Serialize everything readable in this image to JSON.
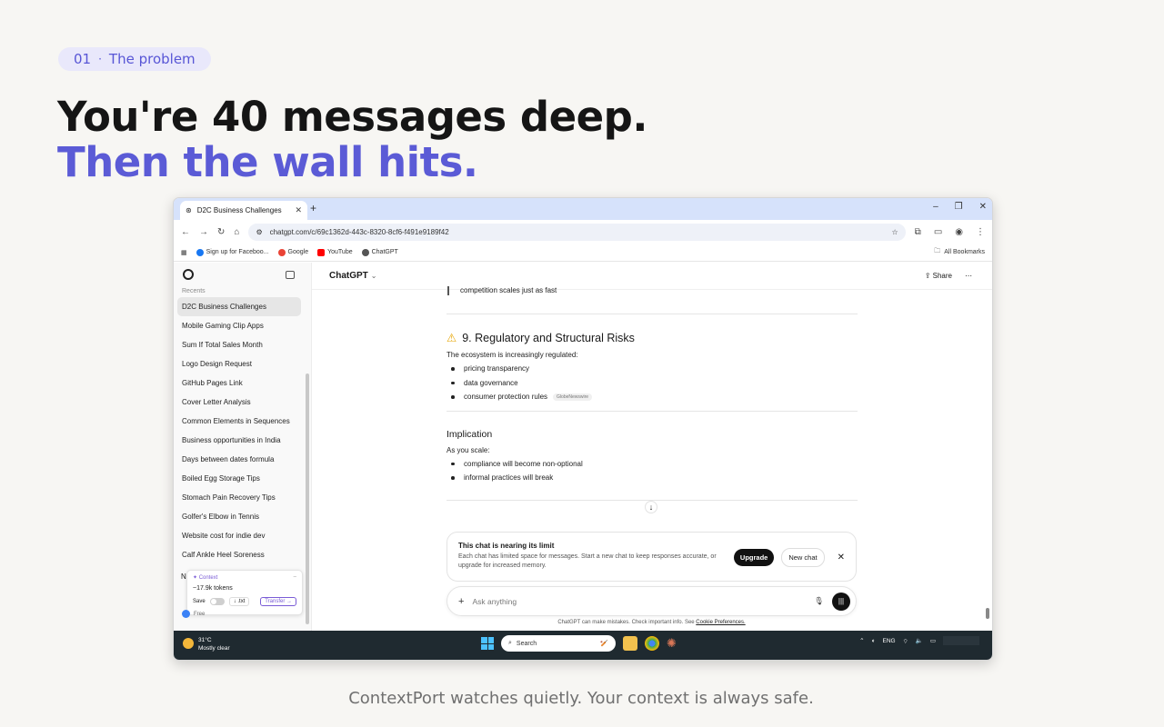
{
  "slide": {
    "step_number": "01",
    "step_label": "The problem",
    "headline_line1": "You're 40 messages deep.",
    "headline_line2": "Then the wall hits.",
    "tagline": "ContextPort watches quietly. Your context is always safe.",
    "accent_color": "#5b5bd6"
  },
  "browser": {
    "tab_title": "D2C Business Challenges",
    "url": "chatgpt.com/c/69c1362d-443c-8320-8cf6-f491e9189f42",
    "bookmarks": [
      {
        "label": "Sign up for Faceboo...",
        "color": "#1877f2"
      },
      {
        "label": "Google",
        "color": "#ea4335"
      },
      {
        "label": "YouTube",
        "color": "#ff0000"
      },
      {
        "label": "ChatGPT",
        "color": "#555555"
      }
    ],
    "all_bookmarks": "All Bookmarks"
  },
  "sidebar": {
    "recents_label": "Recents",
    "chats": [
      "D2C Business Challenges",
      "Mobile Gaming Clip Apps",
      "Sum If Total Sales Month",
      "Logo Design Request",
      "GitHub Pages Link",
      "Cover Letter Analysis",
      "Common Elements in Sequences",
      "Business opportunities in India",
      "Days between dates formula",
      "Boiled Egg Storage Tips",
      "Stomach Pain Recovery Tips",
      "Golfer's Elbow in Tennis",
      "Website cost for indie dev",
      "Calf Ankle Heel Soreness"
    ],
    "partial_item": "N",
    "user_plan": "Free"
  },
  "context_widget": {
    "title": "Context",
    "tokens": "~17.9k tokens",
    "save_label": "Save",
    "txt_label": "↓ .txt",
    "transfer_label": "Transfer →"
  },
  "chat": {
    "model_name": "ChatGPT",
    "share_label": "Share",
    "partial_line": "competition scales just as fast",
    "section_heading": "9. Regulatory and Structural Risks",
    "section_intro": "The ecosystem is increasingly regulated:",
    "section_bullets": [
      "pricing transparency",
      "data governance",
      "consumer protection rules"
    ],
    "citation": "GlobeNewswire",
    "implication_heading": "Implication",
    "implication_intro": "As you scale:",
    "implication_bullets": [
      "compliance will become non-optional",
      "informal practices will break"
    ]
  },
  "limit_banner": {
    "title": "This chat is nearing its limit",
    "description": "Each chat has limited space for messages. Start a new chat to keep responses accurate, or upgrade for increased memory.",
    "upgrade_label": "Upgrade",
    "new_chat_label": "New chat"
  },
  "composer": {
    "placeholder": "Ask anything",
    "disclaimer": "ChatGPT can make mistakes. Check important info. See",
    "disclaimer_link": "Cookie Preferences."
  },
  "taskbar": {
    "temperature": "31°C",
    "condition": "Mostly clear",
    "search_label": "Search",
    "language": "ENG"
  }
}
